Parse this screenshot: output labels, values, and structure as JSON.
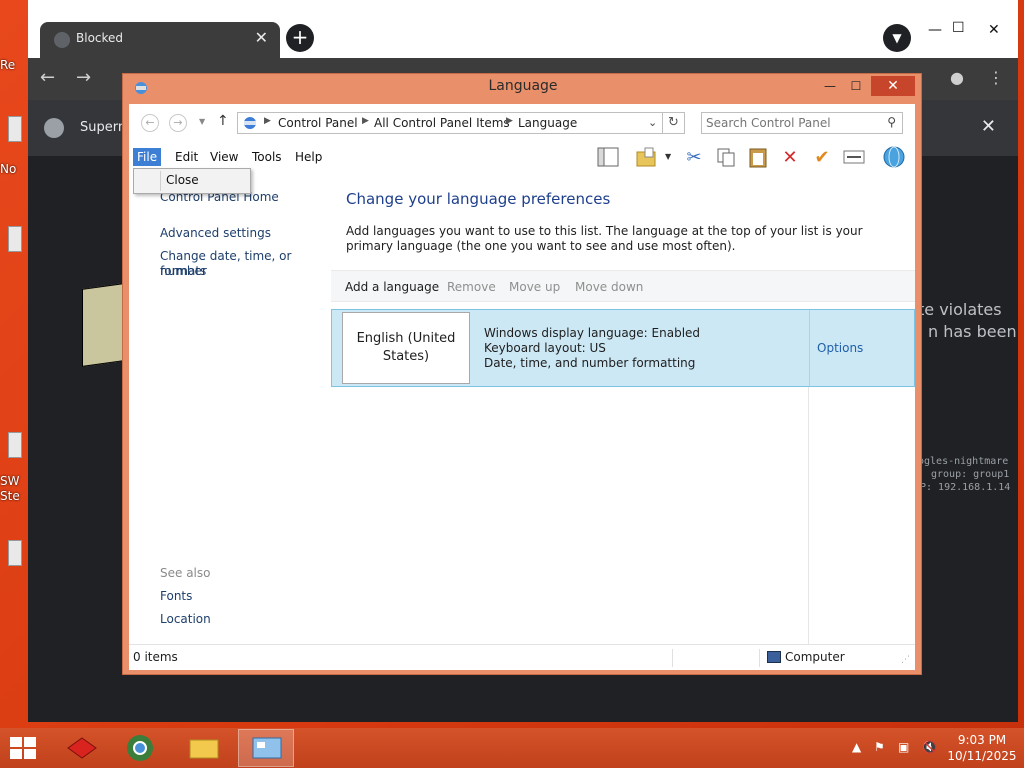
{
  "desktop": {
    "fragments": [
      "Re",
      "No",
      "SW",
      "Ste"
    ]
  },
  "chrome": {
    "tab_title": "Blocked",
    "tab_close": "✕",
    "new_tab": "+",
    "infobar_text": "Superm",
    "infobar_close": "✕",
    "content_text_line1": "te violates",
    "content_text_line2": "n has been",
    "mono_line1": "ogles-nightmare",
    "mono_line2": "group: group1",
    "mono_line3": "P: 192.168.1.14"
  },
  "window": {
    "title": "Language",
    "minimize": "—",
    "maximize": "☐",
    "close": "✕"
  },
  "address": {
    "crumbs": [
      "Control Panel",
      "All Control Panel Items",
      "Language"
    ],
    "refresh": "↻",
    "search_placeholder": "Search Control Panel"
  },
  "menu": {
    "items": [
      "File",
      "Edit",
      "View",
      "Tools",
      "Help"
    ],
    "file_dropdown": [
      "Close"
    ]
  },
  "left_pane": {
    "home": "Control Panel Home",
    "links": [
      "Advanced settings",
      "Change date, time, or number",
      "formats"
    ],
    "see_also_title": "See also",
    "see_also": [
      "Fonts",
      "Location"
    ]
  },
  "main": {
    "heading": "Change your language preferences",
    "description": "Add languages you want to use to this list. The language at the top of your list is your primary language (the one you want to see and use most often).",
    "commands": {
      "add": "Add a language",
      "remove": "Remove",
      "move_up": "Move up",
      "move_down": "Move down"
    },
    "language": {
      "name_line1": "English (United",
      "name_line2": "States)",
      "info": [
        "Windows display language: Enabled",
        "Keyboard layout: US",
        "Date, time, and number formatting"
      ],
      "options": "Options"
    }
  },
  "status": {
    "items": "0 items",
    "location": "Computer"
  },
  "taskbar": {
    "time": "9:03 PM",
    "date": "10/11/2025"
  },
  "colors": {
    "desktop": "#d83a10",
    "window_frame": "#e9906b",
    "close_button": "#c7452a",
    "selection": "#cde8f5",
    "menu_active": "#3d7fd4",
    "link": "#1e3f6b",
    "heading": "#1e3f8c"
  }
}
